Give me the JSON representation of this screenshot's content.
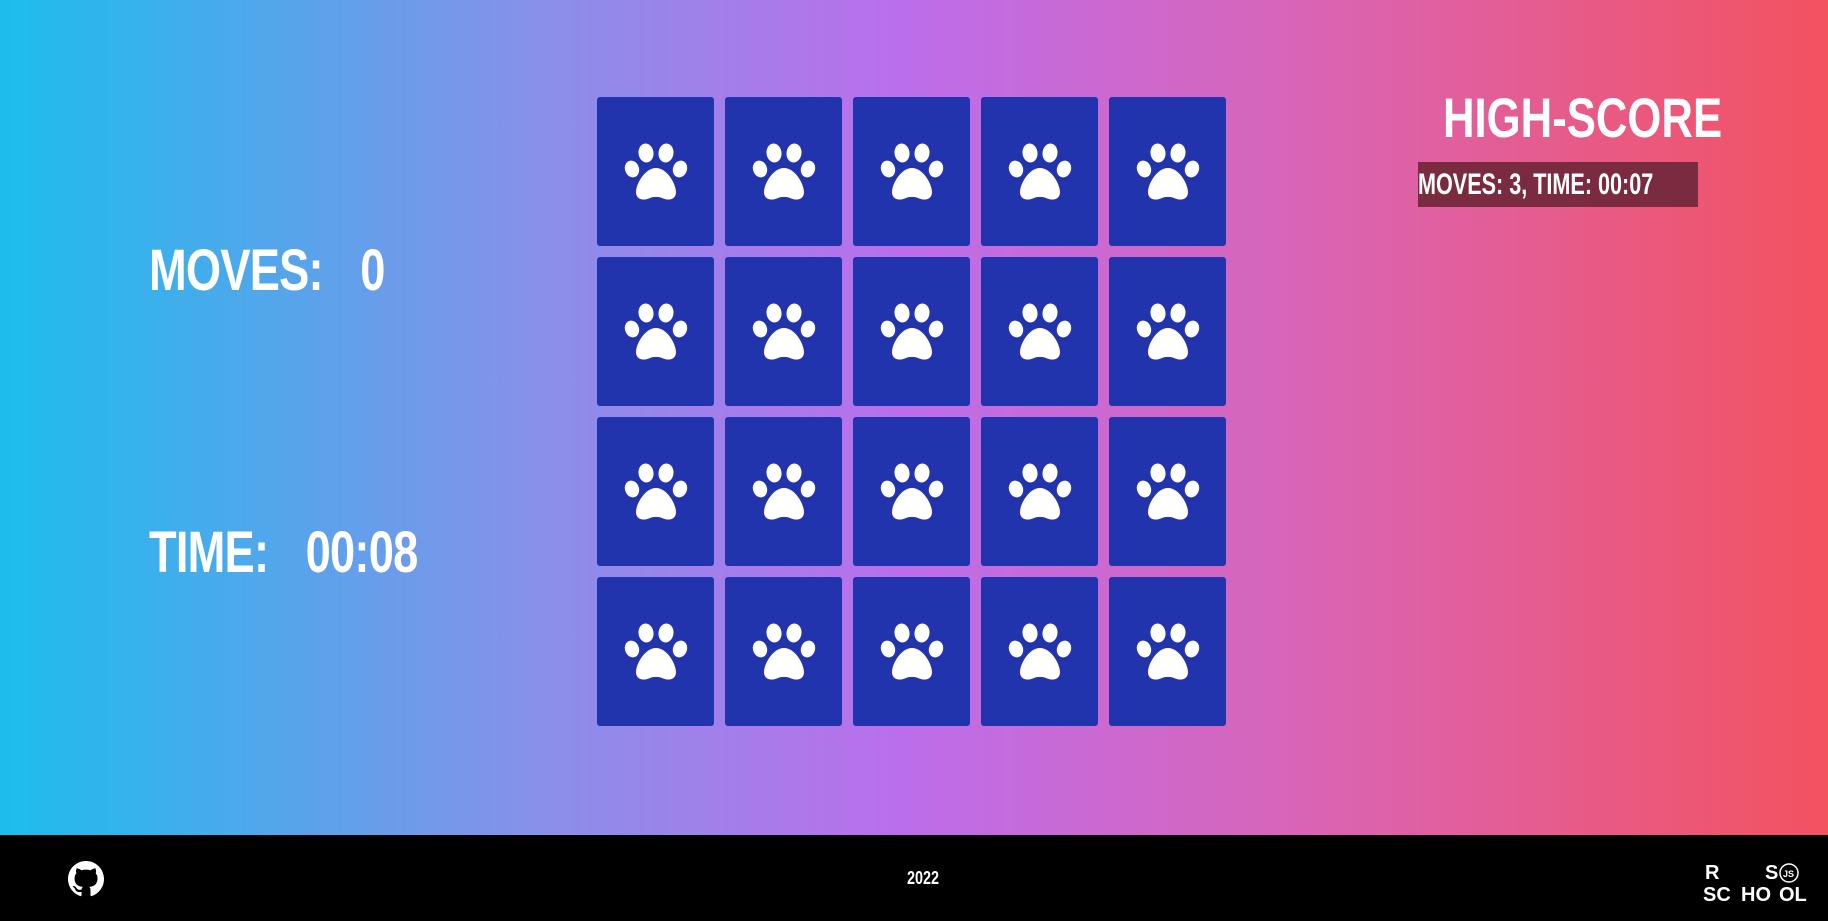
{
  "stats": {
    "moves_label": "MOVES:",
    "moves_value": "0",
    "time_label": "TIME:",
    "time_value": "00:08"
  },
  "board": {
    "rows": 4,
    "columns": 5,
    "card_back_icon": "paw-icon",
    "card_color": "#2134ad",
    "cards": [
      {
        "state": "face-down"
      },
      {
        "state": "face-down"
      },
      {
        "state": "face-down"
      },
      {
        "state": "face-down"
      },
      {
        "state": "face-down"
      },
      {
        "state": "face-down"
      },
      {
        "state": "face-down"
      },
      {
        "state": "face-down"
      },
      {
        "state": "face-down"
      },
      {
        "state": "face-down"
      },
      {
        "state": "face-down"
      },
      {
        "state": "face-down"
      },
      {
        "state": "face-down"
      },
      {
        "state": "face-down"
      },
      {
        "state": "face-down"
      },
      {
        "state": "face-down"
      },
      {
        "state": "face-down"
      },
      {
        "state": "face-down"
      },
      {
        "state": "face-down"
      },
      {
        "state": "face-down"
      }
    ]
  },
  "high_score": {
    "title": "HIGH-SCORE",
    "entries": [
      "MOVES: 3, TIME: 00:07"
    ]
  },
  "footer": {
    "github_icon": "github-icon",
    "year": "2022",
    "logo": {
      "icon": "rs-school-logo",
      "text": "RS SCHOOL JS"
    }
  },
  "colors": {
    "gradient": [
      "#1cbdec",
      "#bd6dea",
      "#f3525f"
    ],
    "card": "#2134ad",
    "high_score_bg": "#7a2b3f",
    "footer_bg": "#000000"
  }
}
